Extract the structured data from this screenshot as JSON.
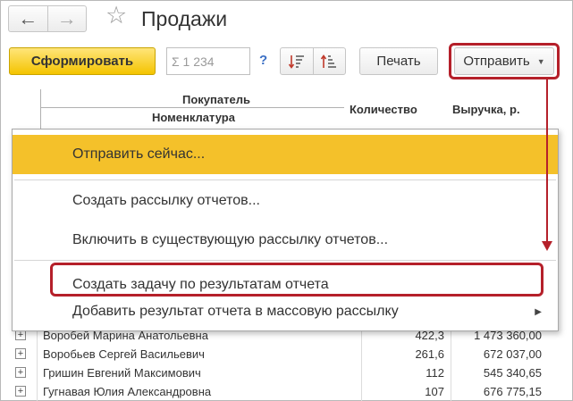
{
  "window": {
    "title": "Продажи"
  },
  "toolbar": {
    "generate_label": "Сформировать",
    "sum_value": "Σ 1 234",
    "help_label": "?",
    "print_label": "Печать",
    "send_label": "Отправить"
  },
  "grid": {
    "headers": {
      "buyer": "Покупатель",
      "item": "Номенклатура",
      "quantity": "Количество",
      "revenue": "Выручка, р."
    },
    "rows": [
      {
        "name": "Воробей Марина Анатольевна",
        "quantity": "422,3",
        "revenue": "1 473 360,00"
      },
      {
        "name": "Воробьев Сергей Васильевич",
        "quantity": "261,6",
        "revenue": "672 037,00"
      },
      {
        "name": "Гришин Евгений Максимович",
        "quantity": "112",
        "revenue": "545 340,65"
      },
      {
        "name": "Гугнавая Юлия Александровна",
        "quantity": "107",
        "revenue": "676 775,15"
      }
    ]
  },
  "menu": {
    "items": [
      {
        "label": "Отправить сейчас..."
      },
      {
        "label": "Создать рассылку отчетов..."
      },
      {
        "label": "Включить в существующую рассылку отчетов..."
      },
      {
        "label": "Создать задачу по результатам отчета"
      },
      {
        "label": "Добавить результат отчета в массовую рассылку"
      }
    ]
  },
  "colors": {
    "accent_yellow": "#f4c12a",
    "annotation_red": "#b5202a",
    "link_blue": "#3b6fc4"
  },
  "icons": {
    "back": "arrow-left-icon",
    "forward": "arrow-right-icon",
    "favorite": "star-icon",
    "sort_asc": "sort-ascending-icon",
    "sort_desc": "sort-descending-icon",
    "expand": "plus-box-icon",
    "submenu": "triangle-right-icon"
  }
}
